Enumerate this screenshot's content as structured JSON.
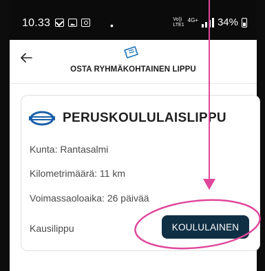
{
  "status_bar": {
    "time": "10.33",
    "dot": "•",
    "network": "4G+",
    "volte_line1": "Vo))",
    "volte_line2": "LTE1",
    "battery_percent": "34%"
  },
  "header": {
    "title": "OSTA RYHMÄKOHTAINEN LIPPU"
  },
  "card": {
    "title": "PERUSKOULULAISLIPPU",
    "kunta": "Kunta: Rantasalmi",
    "kilometers": "Kilometrimäärä: 11 km",
    "validity": "Voimassaoloaika: 26 päivää",
    "season_ticket": "Kausilippu",
    "button_label": "KOULULAINEN"
  },
  "colors": {
    "button_bg": "#0f2f44",
    "annotation": "#e0479c"
  },
  "icons": [
    "mail-icon",
    "photo-icon",
    "app-icon",
    "back-arrow-icon",
    "ticket-icon",
    "matkahuolto-logo-icon",
    "signal-icon",
    "battery-icon"
  ]
}
